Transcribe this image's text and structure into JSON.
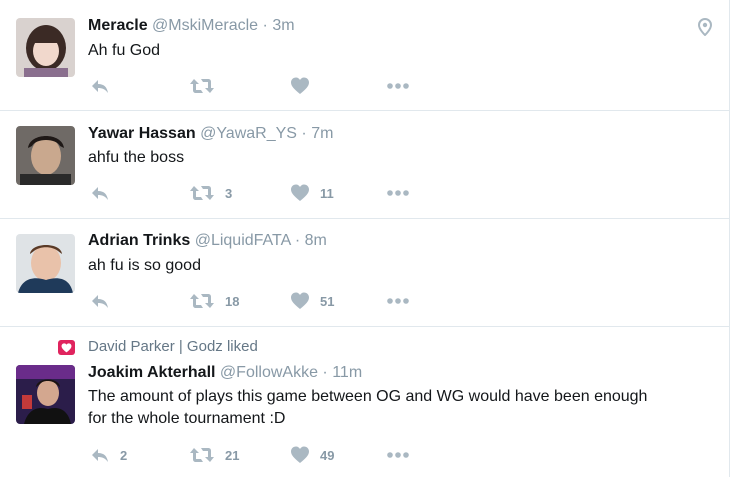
{
  "tweets": [
    {
      "name": "Meracle",
      "handle": "@MskiMeracle",
      "time": "3m",
      "text": "Ah fu God",
      "replies": "",
      "retweets": "",
      "likes": "",
      "has_location": true
    },
    {
      "name": "Yawar Hassan",
      "handle": "@YawaR_YS",
      "time": "7m",
      "text": "ahfu the boss",
      "replies": "",
      "retweets": "3",
      "likes": "11"
    },
    {
      "name": "Adrian Trinks",
      "handle": "@LiquidFATA",
      "time": "8m",
      "text": "ah fu is so good",
      "replies": "",
      "retweets": "18",
      "likes": "51"
    },
    {
      "context": "David Parker | Godz liked",
      "name": "Joakim Akterhall",
      "handle": "@FollowAkke",
      "time": "11m",
      "text_lines": [
        "The amount of plays this game between OG and WG would have been enough",
        "for the whole tournament :D"
      ],
      "replies": "2",
      "retweets": "21",
      "likes": "49"
    }
  ],
  "separator": "·",
  "colors": {
    "muted": "#8899a6",
    "like_badge": "#e0245e",
    "border": "#e1e8ed"
  },
  "icons": [
    "reply-icon",
    "retweet-icon",
    "like-icon",
    "more-icon",
    "location-pin-icon",
    "heart-badge-icon"
  ]
}
